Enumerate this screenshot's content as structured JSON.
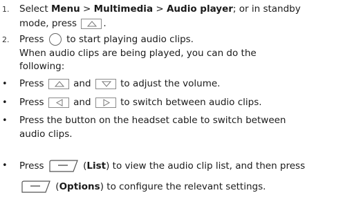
{
  "steps": [
    {
      "number": "1.",
      "parts": {
        "a": "Select ",
        "menu": "Menu",
        "sep1": " > ",
        "multimedia": "Multimedia",
        "sep2": " > ",
        "audio_player": "Audio player",
        "b": "; or in standby",
        "c": "mode, press ",
        "d": "."
      }
    },
    {
      "number": "2.",
      "line1_a": "Press ",
      "line1_b": " to start playing audio clips.",
      "line2": "When audio clips are being played, you can do the",
      "line3": "following:"
    }
  ],
  "bullets": [
    {
      "symbol": "•",
      "a": "Press ",
      "b": " and ",
      "c": " to adjust the volume."
    },
    {
      "symbol": "•",
      "a": "Press ",
      "b": " and ",
      "c": " to switch between audio clips."
    },
    {
      "symbol": "•",
      "line1": "Press the button on the headset cable to switch between",
      "line2": "audio clips."
    },
    {
      "symbol": "•",
      "a": "Press ",
      "b": " (",
      "list": "List",
      "c": ") to view the audio clip list, and then press",
      "d": " (",
      "options": "Options",
      "e": ") to configure the relevant settings."
    }
  ],
  "icons": {
    "up_key": "up-arrow-key-icon",
    "down_key": "down-arrow-key-icon",
    "left_key": "left-arrow-key-icon",
    "right_key": "right-arrow-key-icon",
    "ok_key": "ok-key-icon",
    "soft_key": "soft-key-icon"
  }
}
